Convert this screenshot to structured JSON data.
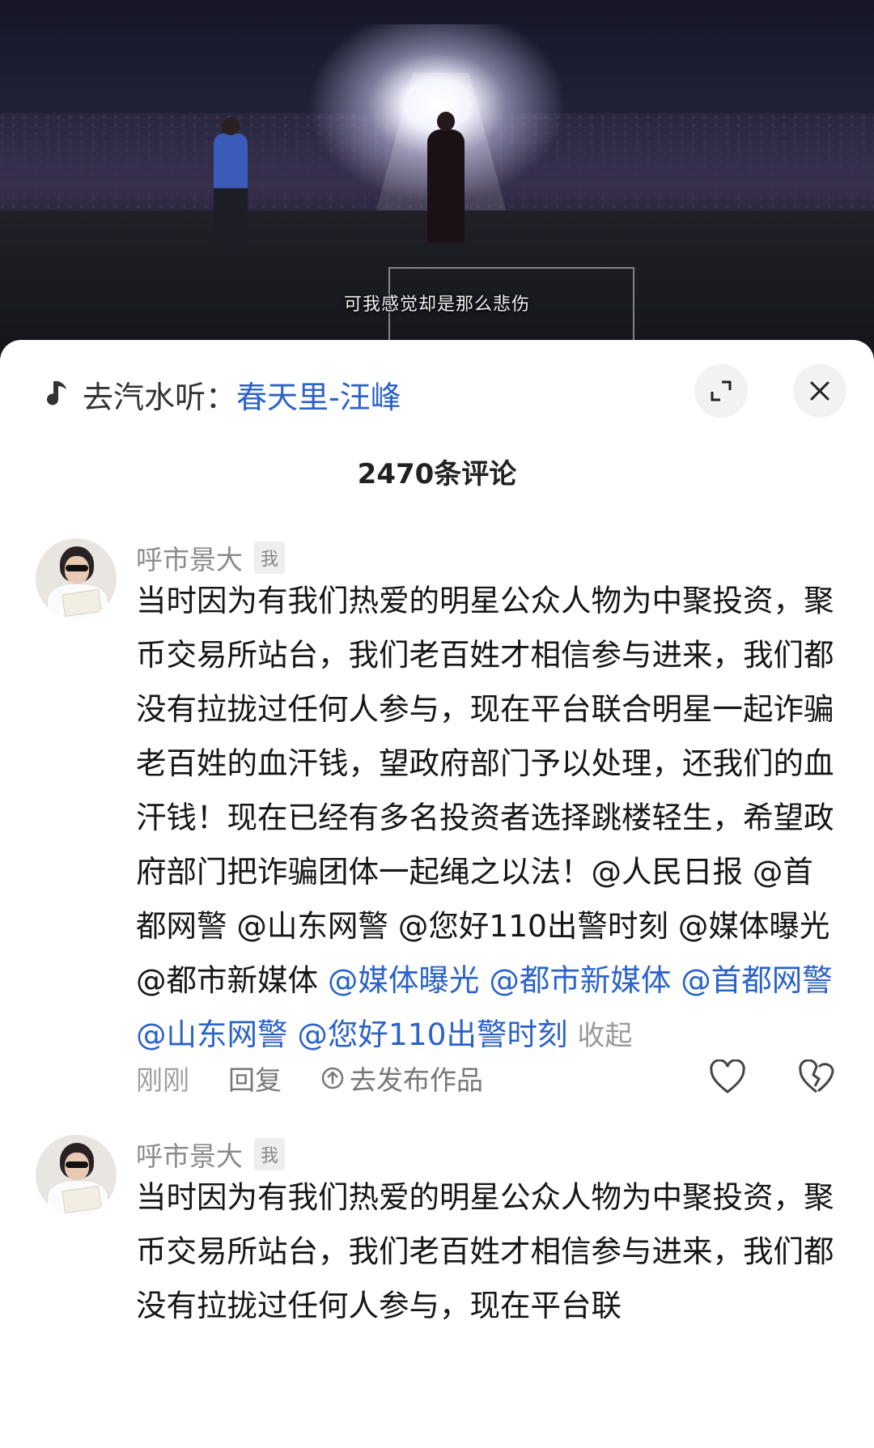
{
  "video": {
    "subtitle": "可我感觉却是那么悲伤"
  },
  "music": {
    "prefix": "去汽水听：",
    "song": "春天里-汪峰",
    "icon": "music-note-icon"
  },
  "header": {
    "comment_count_text": "2470条评论",
    "expand_icon": "expand-icon",
    "close_icon": "close-icon"
  },
  "comments": [
    {
      "username": "呼市景大",
      "badge": "我",
      "text_plain": "当时因为有我们热爱的明星公众人物为中聚投资，聚币交易所站台，我们老百姓才相信参与进来，我们都没有拉拢过任何人参与，现在平台联合明星一起诈骗老百姓的血汗钱，望政府部门予以处理，还我们的血汗钱！现在已经有多名投资者选择跳楼轻生，希望政府部门把诈骗团体一起绳之以法！@人民日报 @首都网警 @山东网警 @您好110出警时刻 @媒体曝光 @都市新媒体 ",
      "text_mentions": "@媒体曝光 @都市新媒体 @首都网警 @山东网警 @您好110出警时刻",
      "collapse_label": "收起",
      "time": "刚刚",
      "reply_label": "回复",
      "goto_label": "去发布作品"
    },
    {
      "username": "呼市景大",
      "badge": "我",
      "text_plain": "当时因为有我们热爱的明星公众人物为中聚投资，聚币交易所站台，我们老百姓才相信参与进来，我们都没有拉拢过任何人参与，现在平台联"
    }
  ],
  "colors": {
    "link_blue": "#2b63c8",
    "text_primary": "#161616",
    "text_secondary": "#8b8b8b"
  }
}
